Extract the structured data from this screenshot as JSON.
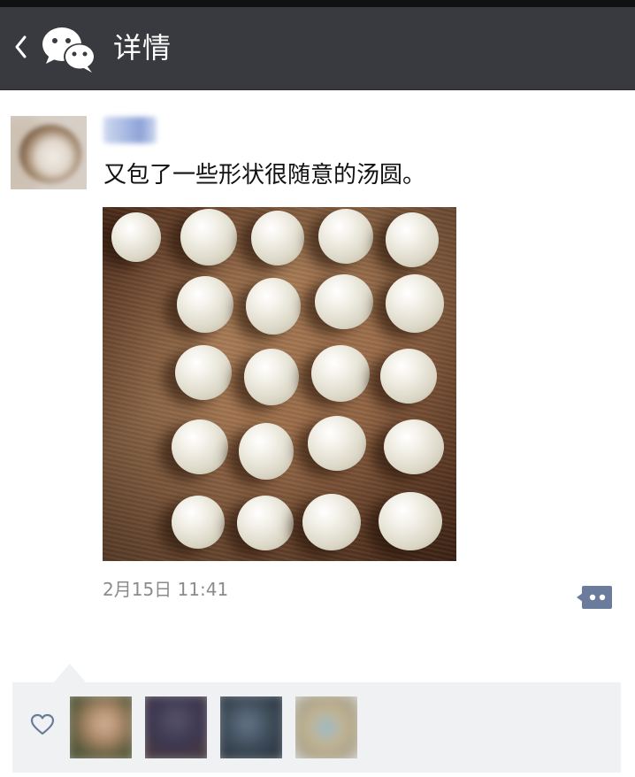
{
  "header": {
    "title": "详情",
    "icons": [
      "back-arrow-icon",
      "wechat-logo-icon"
    ],
    "background_color": "#393a3f"
  },
  "post": {
    "author_nickname": "小满",
    "text": "又包了一些形状很随意的汤圆。",
    "photo_icon": "tangyuan-photo",
    "timestamp": "2月15日 11:41",
    "comment_button_icon": "comment-more-icon",
    "nickname_color": "#576b95"
  },
  "likes": {
    "icon": "heart-outline-icon",
    "likers": [
      "liker-1",
      "liker-2",
      "liker-3",
      "liker-4"
    ],
    "panel_color": "#f0f1f3"
  }
}
